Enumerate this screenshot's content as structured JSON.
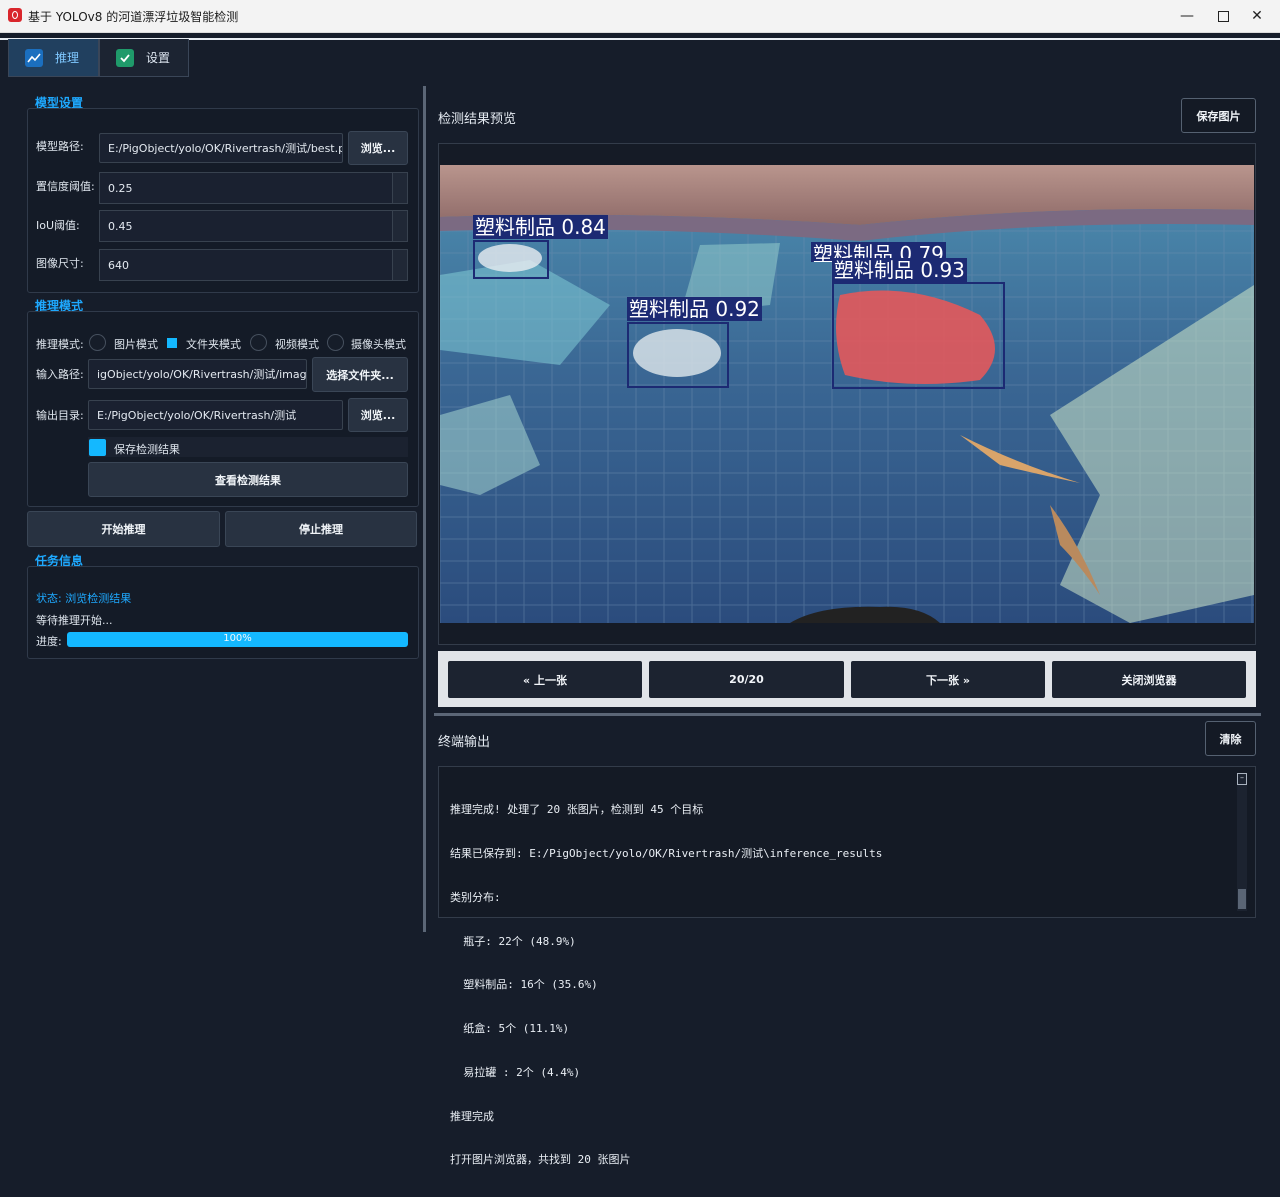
{
  "window": {
    "title": "基于 YOLOv8 的河道漂浮垃圾智能检测"
  },
  "tabs": [
    {
      "label": "推理",
      "active": true,
      "icon": "chart-line-icon"
    },
    {
      "label": "设置",
      "active": false,
      "icon": "checkbox-icon"
    }
  ],
  "model_settings": {
    "section_title": "模型设置",
    "model_path_label": "模型路径:",
    "model_path_value": "E:/PigObject/yolo/OK/Rivertrash/测试/best.pt",
    "browse_label": "浏览...",
    "confidence_label": "置信度阈值:",
    "confidence_value": "0.25",
    "iou_label": "IoU阈值:",
    "iou_value": "0.45",
    "imgsize_label": "图像尺寸:",
    "imgsize_value": "640"
  },
  "inference_mode": {
    "section_title": "推理模式",
    "mode_label": "推理模式:",
    "modes": [
      "图片模式",
      "文件夹模式",
      "视频模式",
      "摄像头模式"
    ],
    "selected_mode": "文件夹模式",
    "input_label": "输入路径:",
    "input_value": "igObject/yolo/OK/Rivertrash/测试/image",
    "select_folder_label": "选择文件夹...",
    "output_label": "输出目录:",
    "output_value": "E:/PigObject/yolo/OK/Rivertrash/测试",
    "output_browse_label": "浏览...",
    "save_results_label": "保存检测结果",
    "save_results_checked": true,
    "view_results_label": "查看检测结果"
  },
  "actions": {
    "start_label": "开始推理",
    "stop_label": "停止推理"
  },
  "task_info": {
    "section_title": "任务信息",
    "status_text": "状态: 浏览检测结果",
    "waiting_text": "等待推理开始...",
    "progress_label": "进度:",
    "progress_text": "100%",
    "progress_value": 1.0
  },
  "preview": {
    "title": "检测结果预览",
    "save_image_label": "保存图片",
    "detections": [
      {
        "label": "塑料制品 0.84"
      },
      {
        "label": "塑料制品 0.92"
      },
      {
        "label": "塑料制品 0.93"
      },
      {
        "label": "塑料制品 0.79"
      }
    ]
  },
  "navigation": {
    "prev_label": "« 上一张",
    "counter": "20/20",
    "next_label": "下一张 »",
    "close_label": "关闭浏览器"
  },
  "terminal": {
    "title": "终端输出",
    "clear_label": "清除",
    "lines": [
      "推理完成! 处理了 20 张图片，检测到 45 个目标",
      "结果已保存到: E:/PigObject/yolo/OK/Rivertrash/测试\\inference_results",
      "类别分布:",
      "  瓶子: 22个 (48.9%)",
      "  塑料制品: 16个 (35.6%)",
      "  纸盒: 5个 (11.1%)",
      "  易拉罐 : 2个 (4.4%)",
      "推理完成",
      "打开图片浏览器，共找到 20 张图片"
    ]
  },
  "colors": {
    "accent": "#1ea9ff",
    "progress": "#14b8ff",
    "box": "#1c2a73"
  }
}
